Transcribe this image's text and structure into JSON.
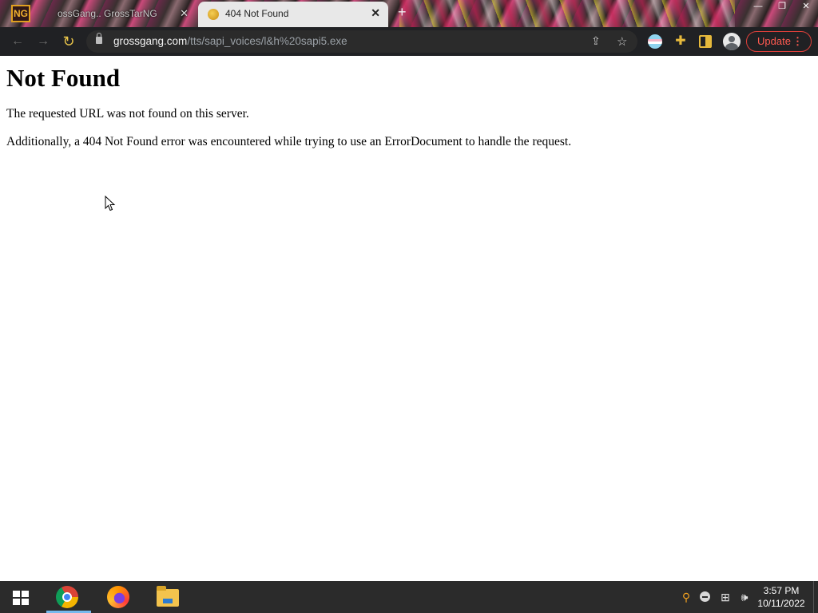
{
  "browser": {
    "tabs": [
      {
        "title": "ossGang.. GrossTarNG",
        "active": false
      },
      {
        "title": "404 Not Found",
        "active": true
      }
    ],
    "address_bar": {
      "domain": "grossgang.com",
      "path": "/tts/sapi_voices/l&h%20sapi5.exe"
    },
    "update_label": "Update",
    "accent_color": "#e0403a"
  },
  "page": {
    "heading": "Not Found",
    "paragraphs": [
      "The requested URL was not found on this server.",
      "Additionally, a 404 Not Found error was encountered while trying to use an ErrorDocument to handle the request."
    ]
  },
  "taskbar": {
    "apps": [
      "chrome-icon",
      "firefox-icon",
      "file-explorer-icon"
    ],
    "time": "3:57 PM",
    "date": "10/11/2022"
  }
}
